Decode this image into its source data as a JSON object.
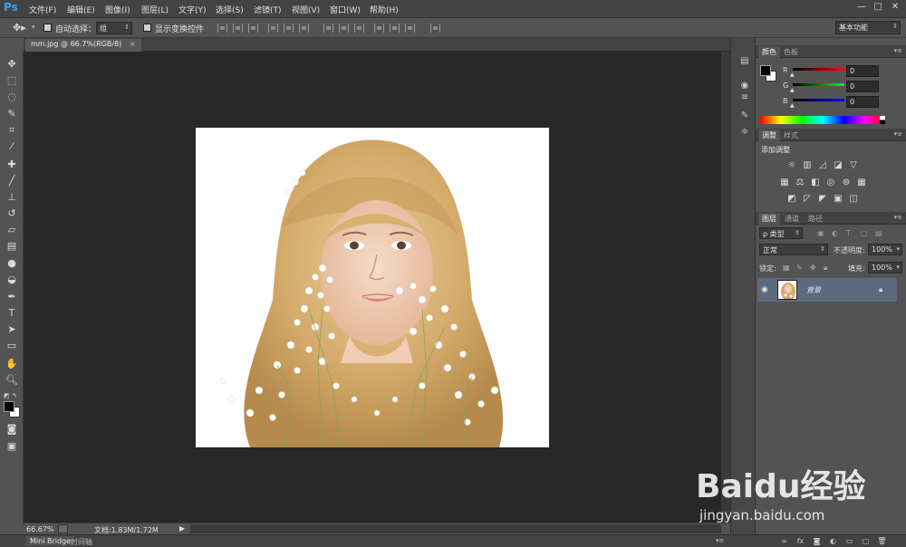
{
  "app": {
    "logo": "Ps"
  },
  "menu": [
    "文件(F)",
    "编辑(E)",
    "图像(I)",
    "图层(L)",
    "文字(Y)",
    "选择(S)",
    "滤镜(T)",
    "视图(V)",
    "窗口(W)",
    "帮助(H)"
  ],
  "window_controls": {
    "minimize": "—",
    "restore": "□",
    "close": "✕"
  },
  "options": {
    "move_tool_icon": "move-tool-icon",
    "auto_select_label": "自动选择：",
    "auto_select_value": "组",
    "show_transform_label": "显示变换控件",
    "workspace": "基本功能"
  },
  "document_tab": {
    "title": "mm.jpg @ 66.7%(RGB/8)",
    "close": "×"
  },
  "status": {
    "zoom": "66.67%",
    "doc_info": "文档:1.83M/1.72M"
  },
  "bottom_tabs": [
    "Mini Bridge",
    "时间轴"
  ],
  "color_panel": {
    "tabs": [
      "颜色",
      "色板"
    ],
    "channels": [
      {
        "label": "R",
        "value": "0",
        "color": "#e02020"
      },
      {
        "label": "G",
        "value": "0",
        "color": "#20c020"
      },
      {
        "label": "B",
        "value": "0",
        "color": "#2040e0"
      }
    ]
  },
  "adjustments_panel": {
    "tabs": [
      "调整",
      "样式"
    ],
    "heading": "添加调整"
  },
  "layers_panel": {
    "tabs": [
      "图层",
      "通道",
      "路径"
    ],
    "filter": "ρ 类型",
    "blend_mode": "正常",
    "opacity_label": "不透明度:",
    "opacity_value": "100%",
    "lock_label": "锁定:",
    "fill_label": "填充:",
    "fill_value": "100%",
    "layer_name": "背景"
  },
  "watermark": {
    "brand": "Baidu经验",
    "url": "jingyan.baidu.com"
  }
}
